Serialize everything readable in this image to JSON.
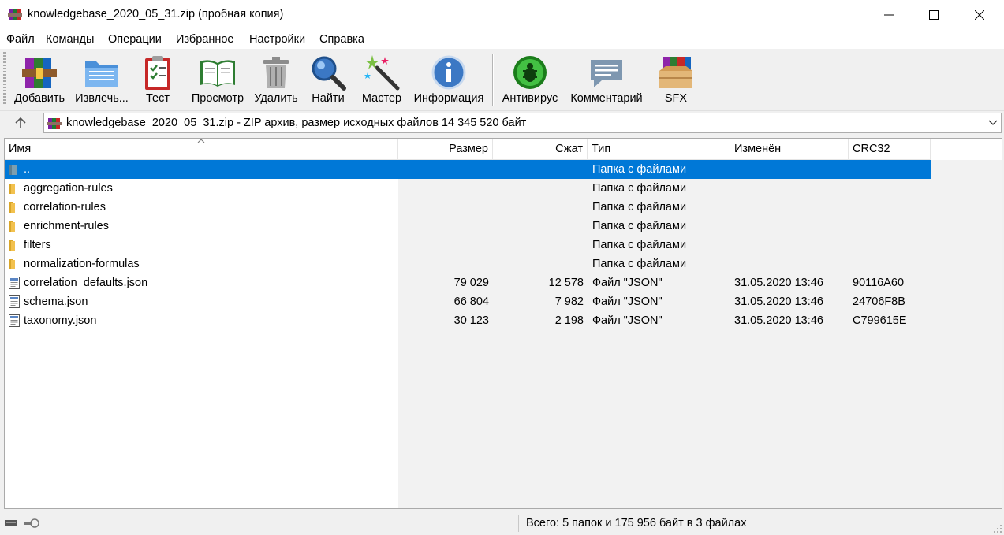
{
  "window": {
    "title": "knowledgebase_2020_05_31.zip (пробная копия)",
    "app_icon": "winrar-books-icon"
  },
  "menu": [
    "Файл",
    "Команды",
    "Операции",
    "Избранное",
    "Настройки",
    "Справка"
  ],
  "toolbar": [
    {
      "label": "Добавить",
      "icon": "add-archive-icon"
    },
    {
      "label": "Извлечь...",
      "icon": "extract-folder-icon"
    },
    {
      "label": "Тест",
      "icon": "test-clipboard-icon"
    },
    {
      "label": "Просмотр",
      "icon": "view-book-icon"
    },
    {
      "label": "Удалить",
      "icon": "trash-icon"
    },
    {
      "label": "Найти",
      "icon": "magnifier-icon"
    },
    {
      "label": "Мастер",
      "icon": "wizard-wand-icon"
    },
    {
      "label": "Информация",
      "icon": "info-icon"
    },
    {
      "label": "Антивирус",
      "icon": "antivirus-bug-icon"
    },
    {
      "label": "Комментарий",
      "icon": "comment-bubble-icon"
    },
    {
      "label": "SFX",
      "icon": "sfx-box-icon"
    }
  ],
  "address": {
    "text": "knowledgebase_2020_05_31.zip - ZIP архив, размер исходных файлов 14 345 520 байт"
  },
  "columns": {
    "name": "Имя",
    "size": "Размер",
    "packed": "Сжат",
    "type": "Тип",
    "modified": "Изменён",
    "crc": "CRC32"
  },
  "files": [
    {
      "name": "..",
      "size": "",
      "packed": "",
      "type": "Папка с файлами",
      "modified": "",
      "crc": "",
      "kind": "parent",
      "selected": true
    },
    {
      "name": "aggregation-rules",
      "size": "",
      "packed": "",
      "type": "Папка с файлами",
      "modified": "",
      "crc": "",
      "kind": "folder"
    },
    {
      "name": "correlation-rules",
      "size": "",
      "packed": "",
      "type": "Папка с файлами",
      "modified": "",
      "crc": "",
      "kind": "folder"
    },
    {
      "name": "enrichment-rules",
      "size": "",
      "packed": "",
      "type": "Папка с файлами",
      "modified": "",
      "crc": "",
      "kind": "folder"
    },
    {
      "name": "filters",
      "size": "",
      "packed": "",
      "type": "Папка с файлами",
      "modified": "",
      "crc": "",
      "kind": "folder"
    },
    {
      "name": "normalization-formulas",
      "size": "",
      "packed": "",
      "type": "Папка с файлами",
      "modified": "",
      "crc": "",
      "kind": "folder"
    },
    {
      "name": "correlation_defaults.json",
      "size": "79 029",
      "packed": "12 578",
      "type": "Файл \"JSON\"",
      "modified": "31.05.2020 13:46",
      "crc": "90116A60",
      "kind": "file"
    },
    {
      "name": "schema.json",
      "size": "66 804",
      "packed": "7 982",
      "type": "Файл \"JSON\"",
      "modified": "31.05.2020 13:46",
      "crc": "24706F8B",
      "kind": "file"
    },
    {
      "name": "taxonomy.json",
      "size": "30 123",
      "packed": "2 198",
      "type": "Файл \"JSON\"",
      "modified": "31.05.2020 13:46",
      "crc": "C799615E",
      "kind": "file"
    }
  ],
  "status": {
    "text": "Всего: 5 папок и 175 956 байт в 3 файлах"
  },
  "colors": {
    "selection": "#0078d7",
    "folder": "#f2c14e"
  }
}
